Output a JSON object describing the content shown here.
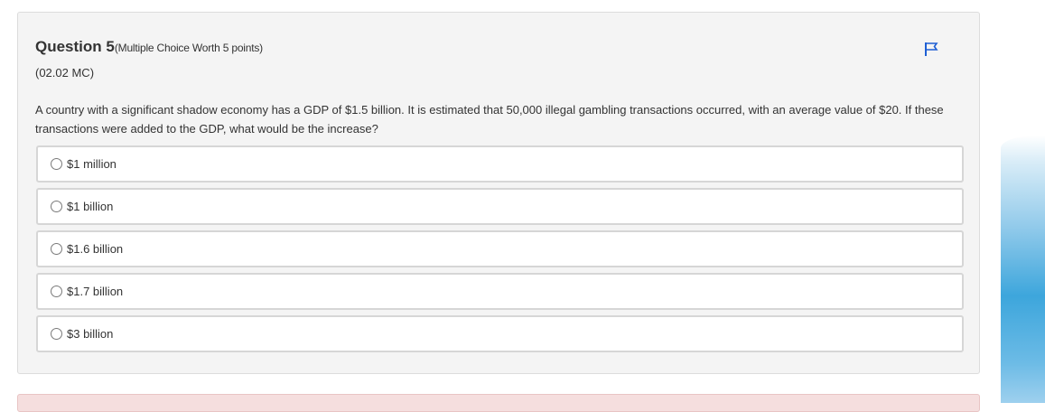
{
  "question": {
    "title": "Question 5",
    "meta": "(Multiple Choice Worth 5 points)",
    "code": "(02.02 MC)",
    "text": "A country with a significant shadow economy has a GDP of $1.5 billion. It is estimated that 50,000 illegal gambling transactions occurred, with an average value of $20. If these transactions were added to the GDP, what would be the increase?",
    "flag_icon": "flag-icon",
    "choices": [
      {
        "label": "$1 million",
        "selected": false
      },
      {
        "label": "$1 billion",
        "selected": false
      },
      {
        "label": "$1.6 billion",
        "selected": false
      },
      {
        "label": "$1.7 billion",
        "selected": false
      },
      {
        "label": "$3 billion",
        "selected": false
      }
    ]
  },
  "colors": {
    "panel_background": "#f4f4f4",
    "flag_accent": "#1e5fd4",
    "next_panel_background": "#f5dede",
    "side_decoration": "#3da6dc"
  }
}
